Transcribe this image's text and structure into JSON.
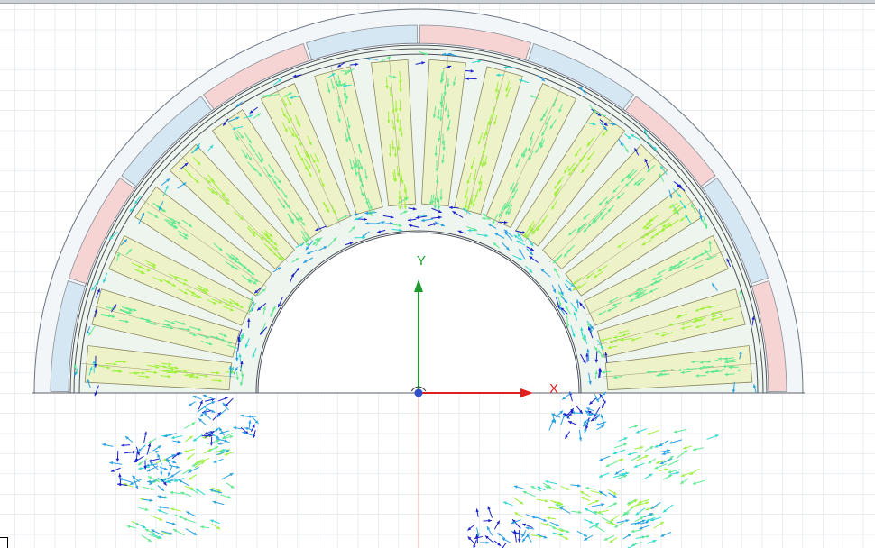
{
  "view": {
    "axis_x_label": "X",
    "axis_y_label": "Y",
    "colors": {
      "background": "#ffffff",
      "grid": "#d6dce6",
      "x_axis": "#e02020",
      "y_axis": "#1c9a2c",
      "coil_red": "#f6d4d4",
      "coil_blue": "#d6e7f4",
      "core_fill": "#eef5ee",
      "slot_fill": "#eef2c8",
      "vector_scale": [
        "#1a22c8",
        "#2aa0e0",
        "#30d8d0",
        "#60e890",
        "#a0f040",
        "#e8e820",
        "#f08020"
      ]
    },
    "icons": [
      "origin-triad-icon"
    ]
  }
}
